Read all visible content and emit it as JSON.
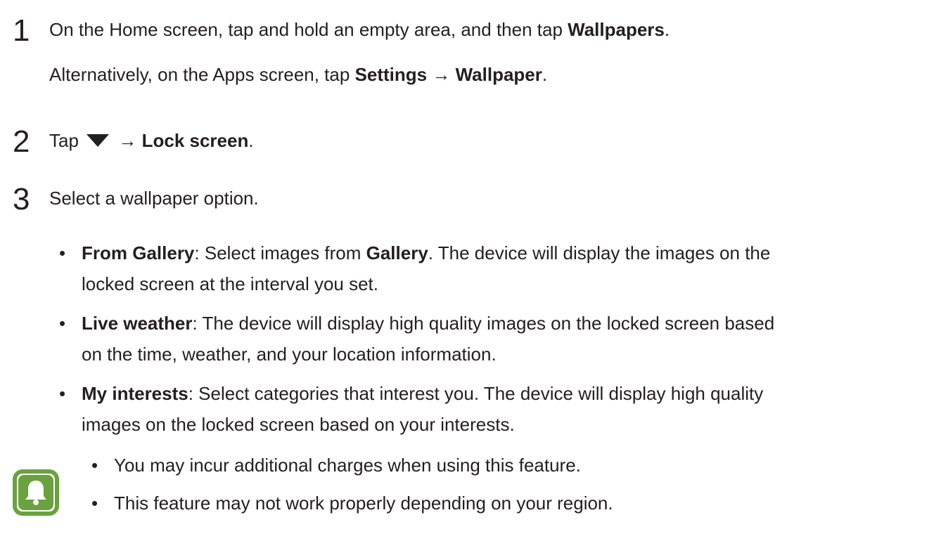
{
  "steps": [
    {
      "number": "1",
      "line1": {
        "pre": "On the Home screen, tap and hold an empty area, and then tap ",
        "b1": "Wallpapers",
        "post": "."
      },
      "line2": {
        "pre": "Alternatively, on the Apps screen, tap ",
        "b1": "Settings",
        "arrow": " → ",
        "b2": "Wallpaper",
        "post": "."
      }
    },
    {
      "number": "2",
      "line1": {
        "pre": "Tap ",
        "arrow": " → ",
        "b1": "Lock screen",
        "post": "."
      }
    },
    {
      "number": "3",
      "line1": {
        "text": "Select a wallpaper option."
      }
    }
  ],
  "options": [
    {
      "bold": "From Gallery",
      "text1": ": Select images from ",
      "bold2": "Gallery",
      "text2": ". The device will display the images on the",
      "line2": "locked screen at the interval you set."
    },
    {
      "bold": "Live weather",
      "text1": ": The device will display high quality images on the locked screen based",
      "line2": "on the time, weather, and your location information."
    },
    {
      "bold": "My interests",
      "text1": ": Select categories that interest you. The device will display high quality",
      "line2": "images on the locked screen based on your interests."
    }
  ],
  "notes": [
    "You may incur additional charges when using this feature.",
    "This feature may not work properly depending on your region."
  ],
  "bullet_char": "•",
  "colors": {
    "text": "#231f20",
    "note_icon": "#6aa23d"
  },
  "icons": {
    "dropdown": "dropdown-triangle-icon",
    "note": "bell-note-icon"
  }
}
